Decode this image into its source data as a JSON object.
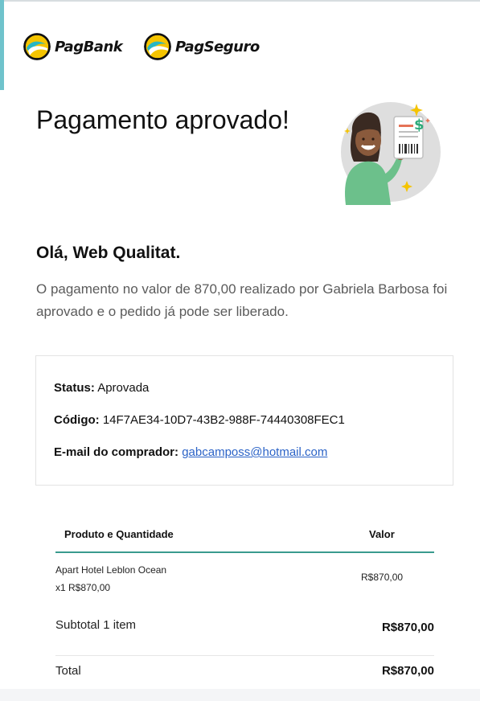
{
  "header": {
    "logos": [
      {
        "name": "PagBank"
      },
      {
        "name": "PagSeguro"
      }
    ]
  },
  "title": "Pagamento aprovado!",
  "greeting": "Olá, Web Qualitat.",
  "message": "O pagamento no valor de 870,00 realizado por Gabriela Barbosa foi aprovado e o pedido já pode ser liberado.",
  "details": {
    "status_label": "Status:",
    "status_value": "Aprovada",
    "code_label": "Código:",
    "code_value": "14F7AE34-10D7-43B2-988F-74440308FEC1",
    "email_label": "E-mail do comprador:",
    "email_value": "gabcamposs@hotmail.com"
  },
  "table": {
    "headers": {
      "product": "Produto e Quantidade",
      "value": "Valor"
    },
    "items": [
      {
        "name": "Apart Hotel Leblon Ocean",
        "qty_price": "x1 R$870,00",
        "value": "R$870,00"
      }
    ],
    "subtotal_label": "Subtotal 1 item",
    "subtotal_value": "R$870,00",
    "total_label": "Total",
    "total_value": "R$870,00"
  },
  "colors": {
    "accent": "#3a9a8e",
    "left_bar": "#6fc3cc",
    "link": "#2b63c7",
    "logo_yellow": "#f5c400",
    "logo_teal": "#28b6c4"
  },
  "icons": {
    "pagbank_logo": "pagbank-logo-icon",
    "pagseguro_logo": "pagseguro-logo-icon",
    "illustration": "woman-with-receipt-illustration"
  }
}
